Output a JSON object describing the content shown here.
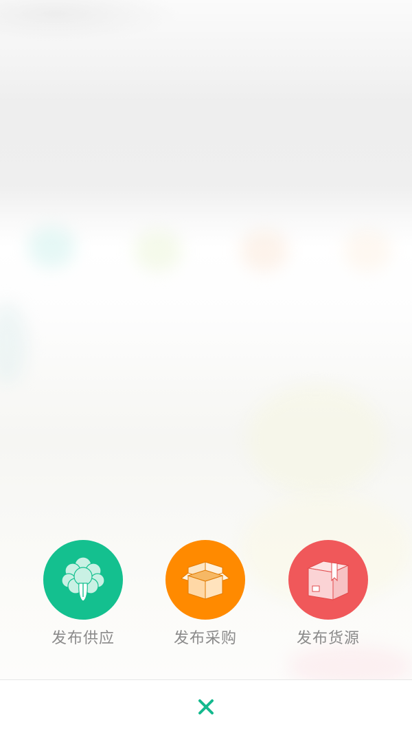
{
  "actions": [
    {
      "label": "发布供应",
      "icon": "vegetable-icon",
      "color": "#14c08f"
    },
    {
      "label": "发布采购",
      "icon": "open-box-icon",
      "color": "#ff8a00"
    },
    {
      "label": "发布货源",
      "icon": "package-icon",
      "color": "#f0585a"
    }
  ],
  "close": {
    "icon": "close-icon",
    "color": "#14b98e"
  }
}
